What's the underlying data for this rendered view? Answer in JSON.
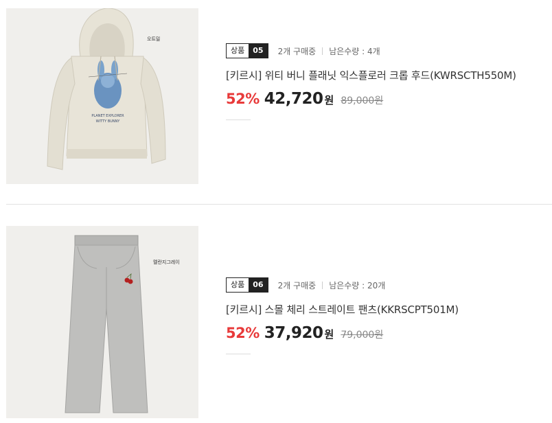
{
  "products": [
    {
      "badge_label": "상품",
      "badge_number": "05",
      "buyers": "2개 구매중",
      "stock": "남은수량 : 4개",
      "title": "[키르시] 위티 버니 플래닛 익스플로러 크롭 후드(KWRSCTH550M)",
      "discount": "52%",
      "price": "42,720",
      "price_unit": "원",
      "original_price": "89,000원",
      "color_tag": "오트밀",
      "image": "oatmeal-cropped-hoodie-bunny-print"
    },
    {
      "badge_label": "상품",
      "badge_number": "06",
      "buyers": "2개 구매중",
      "stock": "남은수량 : 20개",
      "title": "[키르시] 스몰 체리 스트레이트 팬츠(KKRSCPT501M)",
      "discount": "52%",
      "price": "37,920",
      "price_unit": "원",
      "original_price": "79,000원",
      "color_tag": "멜란지그레이",
      "image": "melange-gray-straight-sweatpants-cherry"
    }
  ],
  "colors": {
    "discount": "#e83a3a",
    "badge_dark": "#222222"
  }
}
